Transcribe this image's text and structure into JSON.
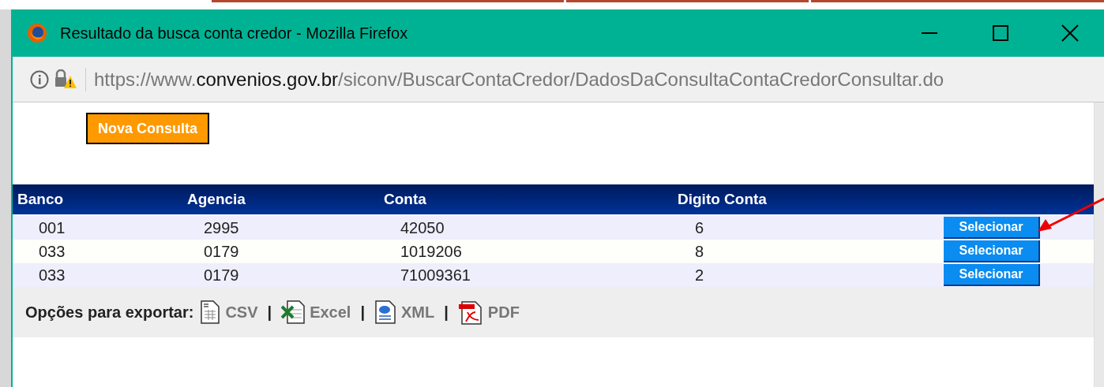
{
  "window": {
    "title": "Resultado da busca conta credor - Mozilla Firefox"
  },
  "address_bar": {
    "scheme": "https://www.",
    "domain": "convenios.gov.br",
    "path": "/siconv/BuscarContaCredor/DadosDaConsultaContaCredorConsultar.do"
  },
  "new_search_button": "Nova Consulta",
  "table": {
    "columns": [
      "Banco",
      "Agencia",
      "Conta",
      "Digito Conta"
    ],
    "rows": [
      {
        "cells": [
          "001",
          "2995",
          "42050",
          "6"
        ],
        "action": "Selecionar"
      },
      {
        "cells": [
          "033",
          "0179",
          "1019206",
          "8"
        ],
        "action": "Selecionar"
      },
      {
        "cells": [
          "033",
          "0179",
          "71009361",
          "2"
        ],
        "action": "Selecionar"
      }
    ]
  },
  "export": {
    "label": "Opções para exportar:",
    "options": [
      {
        "kind": "csv",
        "label": "CSV",
        "separator": "|"
      },
      {
        "kind": "excel",
        "label": "Excel",
        "separator": "|"
      },
      {
        "kind": "xml",
        "label": "XML",
        "separator": "|"
      },
      {
        "kind": "pdf",
        "label": "PDF"
      }
    ]
  }
}
